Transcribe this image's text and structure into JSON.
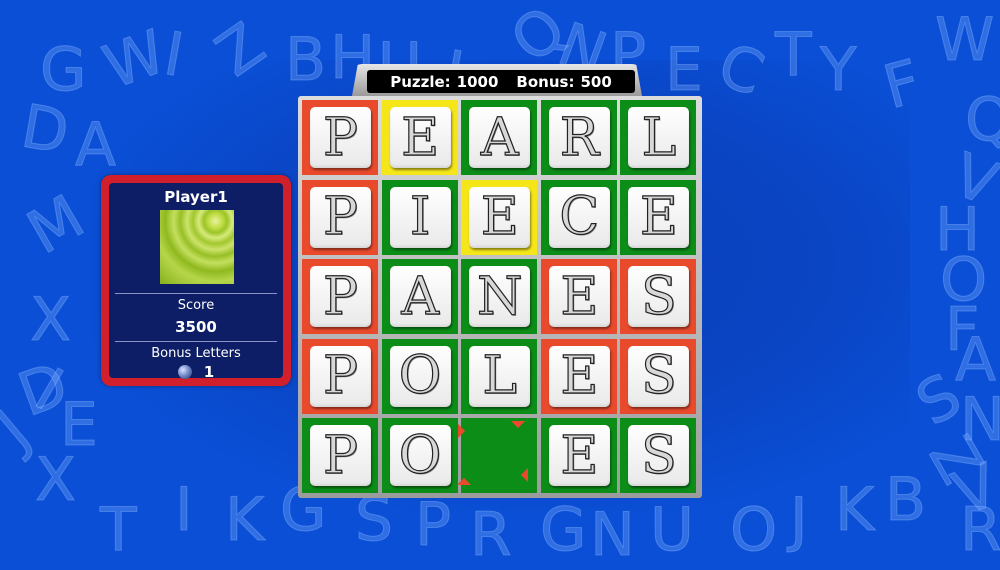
{
  "header": {
    "puzzle_label": "Puzzle:",
    "puzzle_value": "1000",
    "bonus_label": "Bonus:",
    "bonus_value": "500"
  },
  "player": {
    "name": "Player1",
    "score_label": "Score",
    "score_value": "3500",
    "bonus_letters_label": "Bonus Letters",
    "bonus_letters_value": "1",
    "avatar_icon": "green-ripple-avatar",
    "bonus_icon": "orb-icon"
  },
  "board": {
    "rows": [
      [
        {
          "letter": "P",
          "color": "red"
        },
        {
          "letter": "E",
          "color": "yellow"
        },
        {
          "letter": "A",
          "color": "green"
        },
        {
          "letter": "R",
          "color": "green"
        },
        {
          "letter": "L",
          "color": "green"
        }
      ],
      [
        {
          "letter": "P",
          "color": "red"
        },
        {
          "letter": "I",
          "color": "green"
        },
        {
          "letter": "E",
          "color": "yellow"
        },
        {
          "letter": "C",
          "color": "green"
        },
        {
          "letter": "E",
          "color": "green"
        }
      ],
      [
        {
          "letter": "P",
          "color": "red"
        },
        {
          "letter": "A",
          "color": "green"
        },
        {
          "letter": "N",
          "color": "green"
        },
        {
          "letter": "E",
          "color": "red"
        },
        {
          "letter": "S",
          "color": "red"
        }
      ],
      [
        {
          "letter": "P",
          "color": "red"
        },
        {
          "letter": "O",
          "color": "green"
        },
        {
          "letter": "L",
          "color": "green"
        },
        {
          "letter": "E",
          "color": "red"
        },
        {
          "letter": "S",
          "color": "red"
        }
      ],
      [
        {
          "letter": "P",
          "color": "green"
        },
        {
          "letter": "O",
          "color": "green"
        },
        {
          "letter": "",
          "color": "green"
        },
        {
          "letter": "E",
          "color": "green"
        },
        {
          "letter": "S",
          "color": "green"
        }
      ]
    ],
    "colors": {
      "green": "#0b8d17",
      "red": "#e94a2c",
      "yellow": "#f5e61a",
      "marker": "#e94a2c"
    }
  },
  "background_letters": [
    "G",
    "W",
    "I",
    "Z",
    "B",
    "H",
    "U",
    "L",
    "Q",
    "N",
    "P",
    "E",
    "C",
    "T",
    "Y",
    "F",
    "W",
    "D",
    "A",
    "M",
    "Q",
    "V",
    "H",
    "O",
    "F",
    "X",
    "D",
    "A",
    "S",
    "N",
    "Z",
    "V",
    "R",
    "I",
    "J",
    "E",
    "X",
    "T",
    "I",
    "K",
    "G",
    "S",
    "P",
    "R",
    "G",
    "N",
    "U",
    "O",
    "J",
    "K",
    "B"
  ]
}
